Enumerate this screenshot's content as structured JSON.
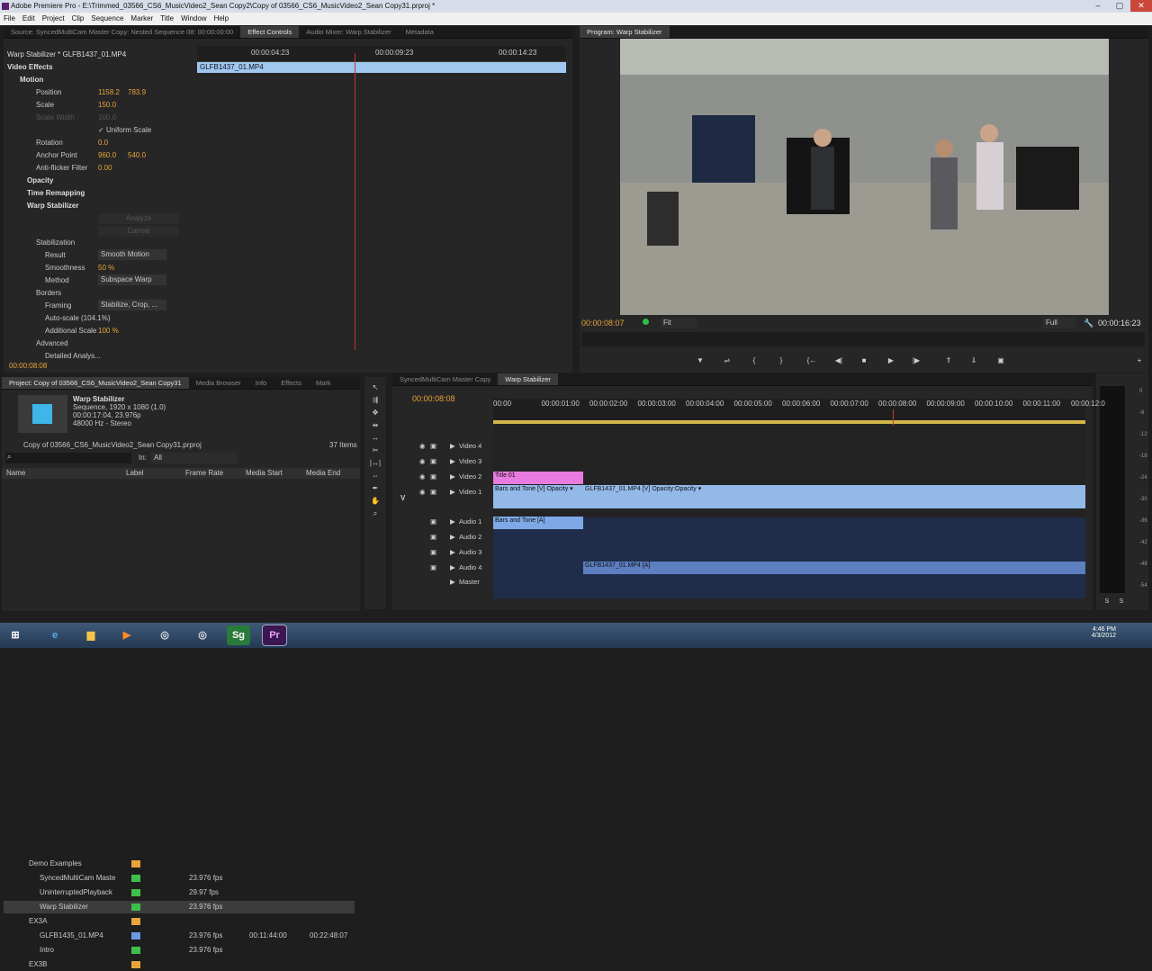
{
  "window": {
    "title": "Adobe Premiere Pro - E:\\Trimmed_03566_CS6_MusicVideo2_Sean Copy2\\Copy of 03566_CS6_MusicVideo2_Sean Copy31.prproj *",
    "minimize": "–",
    "maximize": "▢",
    "close": "✕"
  },
  "menu": [
    "File",
    "Edit",
    "Project",
    "Clip",
    "Sequence",
    "Marker",
    "Title",
    "Window",
    "Help"
  ],
  "source_tabs": [
    "Source: SyncedMultiCam Master Copy: Nested Sequence 08: 00:00:00:00",
    "Effect Controls",
    "Audio Mixer: Warp Stabilizer",
    "Metadata"
  ],
  "effect_controls": {
    "clip_path": "Warp Stabilizer * GLFB1437_01.MP4",
    "ruler": [
      "00:00:04:23",
      "00:00:09:23",
      "00:00:14:23"
    ],
    "clip_bar": "GLFB1437_01.MP4",
    "video_effects": "Video Effects",
    "motion": "Motion",
    "position": "Position",
    "position_x": "1158.2",
    "position_y": "783.9",
    "scale": "Scale",
    "scale_val": "150.0",
    "scale_width": "Scale Width",
    "scale_width_val": "100.0",
    "uniform_scale": "Uniform Scale",
    "rotation": "Rotation",
    "rotation_val": "0.0",
    "anchor": "Anchor Point",
    "anchor_x": "960.0",
    "anchor_y": "540.0",
    "flicker": "Anti-flicker Filter",
    "flicker_val": "0.00",
    "opacity": "Opacity",
    "time_remap": "Time Remapping",
    "warp": "Warp Stabilizer",
    "analyze": "Analyze",
    "cancel": "Cancel",
    "stabilization": "Stabilization",
    "result": "Result",
    "result_val": "Smooth Motion",
    "smoothness": "Smoothness",
    "smoothness_val": "50 %",
    "method": "Method",
    "method_val": "Subspace Warp",
    "borders": "Borders",
    "framing": "Framing",
    "framing_val": "Stabilize, Crop, ...",
    "autoscale": "Auto-scale (104.1%)",
    "addscale": "Additional Scale",
    "addscale_val": "100 %",
    "advanced": "Advanced",
    "detailed": "Detailed Analys...",
    "timecode": "00:00:08:08"
  },
  "program": {
    "tab": "Program: Warp Stabilizer",
    "timecode": "00:00:08:07",
    "fit": "Fit",
    "quality": "Full",
    "duration": "00:00:16:23"
  },
  "project": {
    "tabs": [
      "Project: Copy of 03566_CS6_MusicVideo2_Sean Copy31",
      "Media Browser",
      "Info",
      "Effects",
      "Mark"
    ],
    "seq_name": "Warp Stabilizer",
    "seq_info1": "Sequence, 1920 x 1080 (1.0)",
    "seq_info2": "00:00:17:04, 23.976p",
    "seq_info3": "48000 Hz - Stereo",
    "file": "Copy of 03566_CS6_MusicVideo2_Sean Copy31.prproj",
    "items": "37 Items",
    "in_label": "In:",
    "in_val": "All",
    "cols": [
      "Name",
      "Label",
      "Frame Rate",
      "Media Start",
      "Media End"
    ],
    "rows": [
      {
        "name": "Demo Examples",
        "rate": "",
        "start": "",
        "end": "",
        "color": "#e8a33a"
      },
      {
        "name": "SyncedMultiCam Maste",
        "rate": "23.976 fps",
        "start": "",
        "end": "",
        "color": "#3fbf4a"
      },
      {
        "name": "UninterruptedPlayback",
        "rate": "29.97 fps",
        "start": "",
        "end": "",
        "color": "#3fbf4a"
      },
      {
        "name": "Warp Stabilizer",
        "rate": "23.976 fps",
        "start": "",
        "end": "",
        "color": "#3fbf4a"
      },
      {
        "name": "EX3A",
        "rate": "",
        "start": "",
        "end": "",
        "color": "#e8a33a"
      },
      {
        "name": "GLFB1435_01.MP4",
        "rate": "23.976 fps",
        "start": "00:11:44:00",
        "end": "00:22:48:07",
        "color": "#6a9be0"
      },
      {
        "name": "Intro",
        "rate": "23.976 fps",
        "start": "",
        "end": "",
        "color": "#3fbf4a"
      },
      {
        "name": "EX3B",
        "rate": "",
        "start": "",
        "end": "",
        "color": "#e8a33a"
      }
    ]
  },
  "timeline": {
    "tabs": [
      "SyncedMultiCam Master Copy",
      "Warp Stabilizer"
    ],
    "timecode": "00:00:08:08",
    "ruler": [
      "00:00",
      "00:00:01:00",
      "00:00:02:00",
      "00:00:03:00",
      "00:00:04:00",
      "00:00:05:00",
      "00:00:06:00",
      "00:00:07:00",
      "00:00:08:00",
      "00:00:09:00",
      "00:00:10:00",
      "00:00:11:00",
      "00:00:12:0"
    ],
    "tracks": [
      "Video 4",
      "Video 3",
      "Video 2",
      "Video 1",
      "Audio 1",
      "Audio 2",
      "Audio 3",
      "Audio 4",
      "Master"
    ],
    "v_label": "V",
    "clips": {
      "title": "Title 01",
      "bars_v": "Bars and Tone [V]",
      "bars_opacity": "Opacity ▾",
      "glfb_v": "GLFB1437_01.MP4 [V]",
      "glfb_opacity": "Opacity:Opacity ▾",
      "bars_a": "Bars and Tone [A]",
      "glfb_a": "GLFB1437_01.MP4 [A]"
    }
  },
  "vu_scale": [
    "0",
    "-6",
    "-12",
    "-18",
    "-24",
    "-30",
    "-36",
    "-42",
    "-48",
    "-54"
  ],
  "vu_solo": "S",
  "taskbar": {
    "time": "4:46 PM",
    "date": "4/3/2012"
  }
}
